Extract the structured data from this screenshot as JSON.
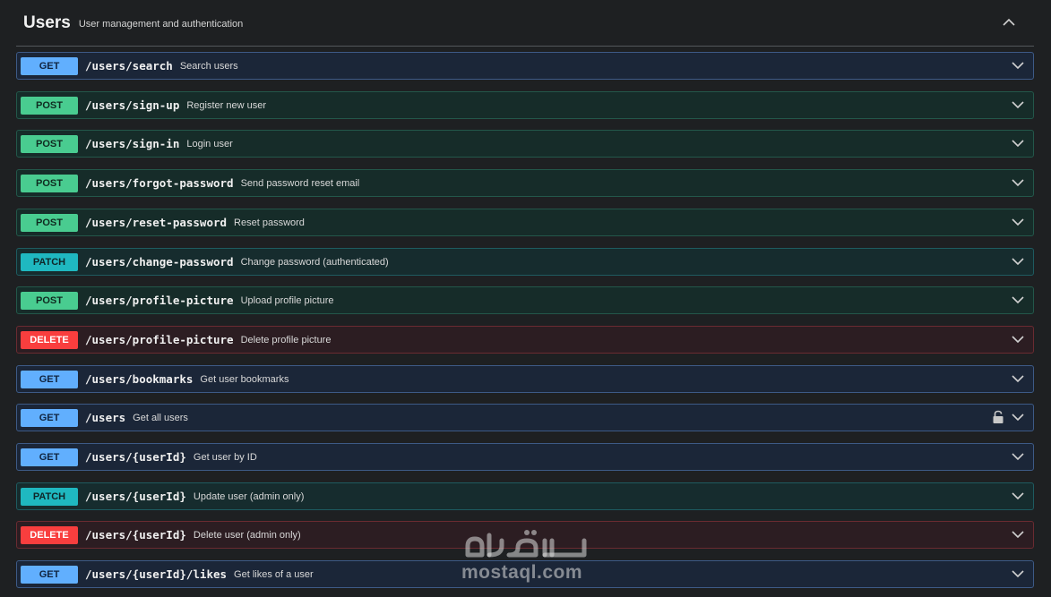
{
  "section": {
    "title": "Users",
    "description": "User management and authentication"
  },
  "operations": [
    {
      "method": "GET",
      "path": "/users/search",
      "summary": "Search users",
      "locked": false
    },
    {
      "method": "POST",
      "path": "/users/sign-up",
      "summary": "Register new user",
      "locked": false
    },
    {
      "method": "POST",
      "path": "/users/sign-in",
      "summary": "Login user",
      "locked": false
    },
    {
      "method": "POST",
      "path": "/users/forgot-password",
      "summary": "Send password reset email",
      "locked": false
    },
    {
      "method": "POST",
      "path": "/users/reset-password",
      "summary": "Reset password",
      "locked": false
    },
    {
      "method": "PATCH",
      "path": "/users/change-password",
      "summary": "Change password (authenticated)",
      "locked": false
    },
    {
      "method": "POST",
      "path": "/users/profile-picture",
      "summary": "Upload profile picture",
      "locked": false
    },
    {
      "method": "DELETE",
      "path": "/users/profile-picture",
      "summary": "Delete profile picture",
      "locked": false
    },
    {
      "method": "GET",
      "path": "/users/bookmarks",
      "summary": "Get user bookmarks",
      "locked": false
    },
    {
      "method": "GET",
      "path": "/users",
      "summary": "Get all users",
      "locked": true
    },
    {
      "method": "GET",
      "path": "/users/{userId}",
      "summary": "Get user by ID",
      "locked": false
    },
    {
      "method": "PATCH",
      "path": "/users/{userId}",
      "summary": "Update user (admin only)",
      "locked": false
    },
    {
      "method": "DELETE",
      "path": "/users/{userId}",
      "summary": "Delete user (admin only)",
      "locked": false
    },
    {
      "method": "GET",
      "path": "/users/{userId}/likes",
      "summary": "Get likes of a user",
      "locked": false
    }
  ],
  "icons": {
    "collapse": "chevron-up-icon",
    "expand": "chevron-down-icon",
    "lock": "lock-open-icon"
  },
  "colors": {
    "get": "#61affe",
    "post": "#49cc90",
    "patch": "#1fb8c0",
    "delete": "#f93e3e"
  },
  "watermark": {
    "text": "mostaql.com",
    "logo_text": "مستقل"
  }
}
